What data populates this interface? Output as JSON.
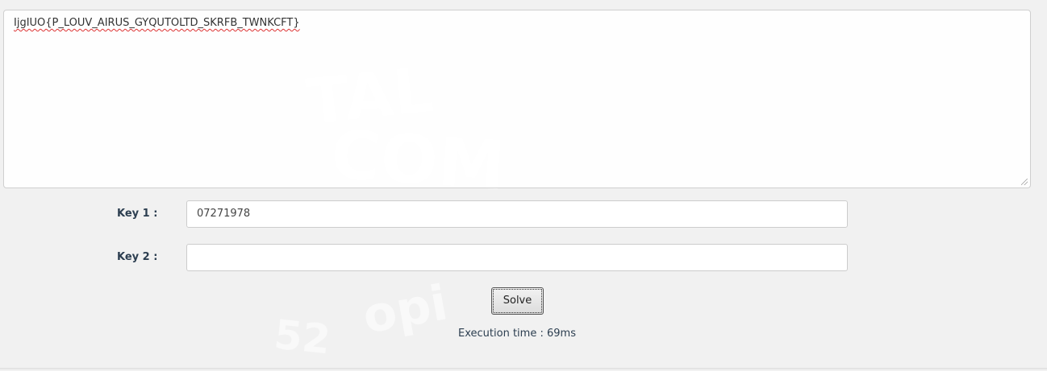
{
  "ciphertext": "IjgIUO{P_LOUV_AIRUS_GYQUTOLTD_SKRFB_TWNKCFT}",
  "key1": {
    "label": "Key 1 :",
    "value": "07271978"
  },
  "key2": {
    "label": "Key 2 :",
    "value": ""
  },
  "solve_label": "Solve",
  "execution": {
    "label": "Execution time : ",
    "value": "69ms"
  }
}
